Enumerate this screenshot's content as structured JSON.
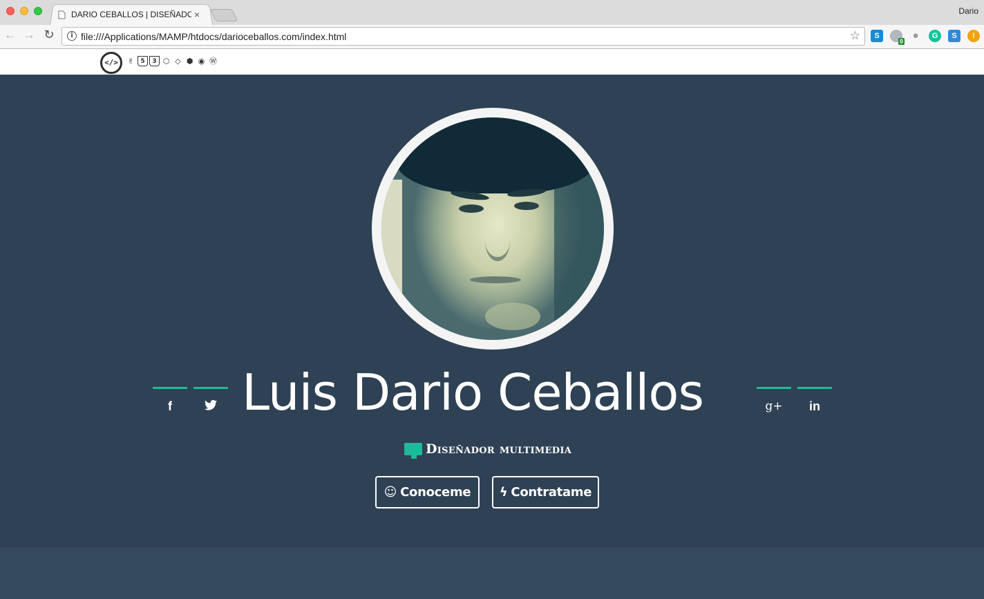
{
  "browser": {
    "tab_title": "DARIO CEBALLOS | DISEÑADOR",
    "tab_close": "×",
    "profile_name": "Dario",
    "url": "file:///Applications/MAMP/htdocs/darioceballos.com/index.html",
    "back": "←",
    "forward": "→",
    "reload": "↻",
    "info": "i",
    "star": "☆",
    "extensions": [
      {
        "name": "skype-extension-icon",
        "label": "S",
        "color": "#1a8ad4"
      },
      {
        "name": "counter-extension-icon",
        "label": "0",
        "color": "#9aa3a8"
      },
      {
        "name": "ghostery-extension-icon",
        "label": "",
        "color": "#a7a7a7"
      },
      {
        "name": "grammarly-extension-icon",
        "label": "G",
        "color": "#15c39a"
      },
      {
        "name": "screenshot-extension-icon",
        "label": "S",
        "color": "#2f8ad8"
      },
      {
        "name": "alert-extension-icon",
        "label": "!",
        "color": "#f4a211"
      }
    ]
  },
  "site": {
    "logo": "</>",
    "skills": [
      "✌",
      "5",
      "3",
      "⬡",
      "◇",
      "⬢",
      "◉",
      "Ⓦ"
    ],
    "name": "Luis Dario Ceballos",
    "subtitle": "Diseñador multimedia",
    "social": {
      "facebook": "f",
      "twitter": "✦",
      "googleplus": "g+",
      "linkedin": "in"
    },
    "buttons": {
      "about_icon": "☺",
      "about": "Conoceme",
      "hire_icon": "ϟ",
      "hire": "Contratame"
    },
    "colors": {
      "hero_bg": "#2f4154",
      "accent": "#1abc9c"
    }
  }
}
